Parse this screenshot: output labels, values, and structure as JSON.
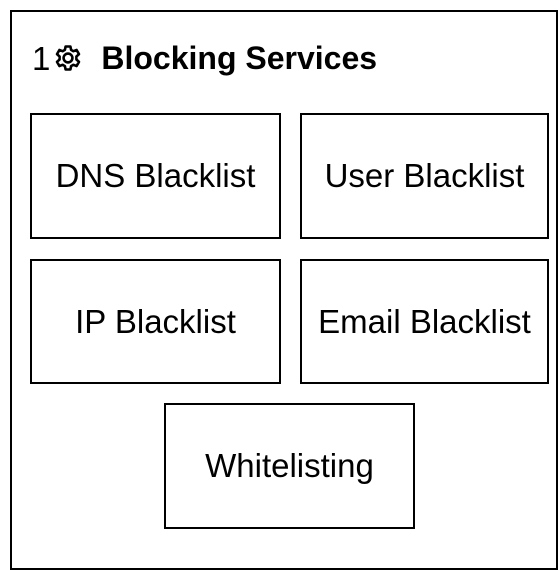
{
  "header": {
    "number": "1",
    "icon": "gear-icon",
    "title": "Blocking Services"
  },
  "services": {
    "dns_blacklist": "DNS Blacklist",
    "user_blacklist": "User Blacklist",
    "ip_blacklist": "IP Blacklist",
    "email_blacklist": "Email Blacklist",
    "whitelisting": "Whitelisting"
  },
  "colors": {
    "stroke": "#000000",
    "background": "#ffffff"
  }
}
